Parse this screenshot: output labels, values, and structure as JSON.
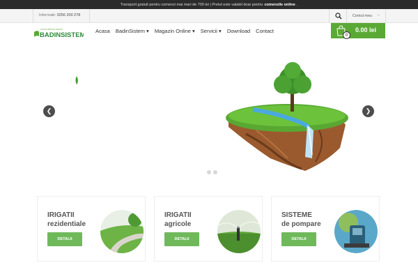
{
  "topbar": {
    "text": "Transport gratuit pentru comenzi mai mari de 700 lei | Pretul este valabil doar pentru",
    "bold": "comenzile online",
    "end": "."
  },
  "info": {
    "label": "Informatii:",
    "phone": "0256 200 278"
  },
  "account": {
    "label": "Contul meu"
  },
  "logo": {
    "text": "BADINSISTEM",
    "tagline": "SOLUTII PENTRU IRIGATII"
  },
  "nav": {
    "items": [
      {
        "label": "Acasa"
      },
      {
        "label": "BadinSistem ▾"
      },
      {
        "label": "Magazin Online ▾"
      },
      {
        "label": "Servicii ▾"
      },
      {
        "label": "Download"
      },
      {
        "label": "Contact"
      }
    ]
  },
  "cart": {
    "count": "0",
    "total": "0.00 lei"
  },
  "cards": [
    {
      "line1": "IRIGATII",
      "line2": "rezidentiale",
      "button": "DETALII"
    },
    {
      "line1": "IRIGATII",
      "line2": "agricole",
      "button": "DETALII"
    },
    {
      "line1": "SISTEME",
      "line2": "de pompare",
      "button": "DETALII"
    }
  ],
  "colors": {
    "accent": "#5aa935",
    "button": "#6fb95b",
    "topbar": "#2b2b2b"
  }
}
